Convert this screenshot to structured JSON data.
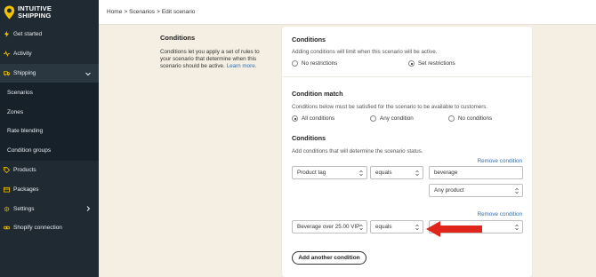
{
  "brand": {
    "line1": "INTUITIVE",
    "line2": "SHIPPING",
    "color": "#f2c200"
  },
  "sidebar": {
    "items": [
      {
        "label": "Get started",
        "icon": "lightning-icon"
      },
      {
        "label": "Activity",
        "icon": "pulse-icon"
      },
      {
        "label": "Shipping",
        "icon": "truck-icon"
      },
      {
        "label": "Scenarios"
      },
      {
        "label": "Zones"
      },
      {
        "label": "Rate blending"
      },
      {
        "label": "Condition groups"
      },
      {
        "label": "Products",
        "icon": "tag-icon"
      },
      {
        "label": "Packages",
        "icon": "box-icon"
      },
      {
        "label": "Settings",
        "icon": "gear-icon"
      },
      {
        "label": "Shopify connection",
        "icon": "link-icon"
      }
    ]
  },
  "breadcrumb": {
    "home": "Home",
    "sep": ">",
    "scenarios": "Scenarios",
    "current": "Edit scenario"
  },
  "intro": {
    "title": "Conditions",
    "text": "Conditions let you apply a set of rules to your scenario that determine when this scenario should be active.",
    "link": "Learn more."
  },
  "conditions_section": {
    "title": "Conditions",
    "desc": "Adding conditions will limit when this scenario will be active.",
    "options": [
      "No restrictions",
      "Set restrictions"
    ],
    "selected": "Set restrictions"
  },
  "match_section": {
    "title": "Condition match",
    "desc": "Conditions below must be satisfied for the scenario to be available to customers.",
    "options": [
      "All conditions",
      "Any condition",
      "No conditions"
    ],
    "selected": "All conditions"
  },
  "rules_section": {
    "title": "Conditions",
    "desc": "Add conditions that will determine the scenario status.",
    "remove_label": "Remove condition",
    "rule1": {
      "field": "Product tag",
      "operator": "equals",
      "value": "beverage",
      "scope": "Any product"
    },
    "rule2": {
      "field": "Beverage over 25.00 VIP",
      "operator": "equals",
      "value": ""
    },
    "add_button": "Add another condition"
  },
  "annotation": {
    "arrow_color": "#e0261c"
  }
}
